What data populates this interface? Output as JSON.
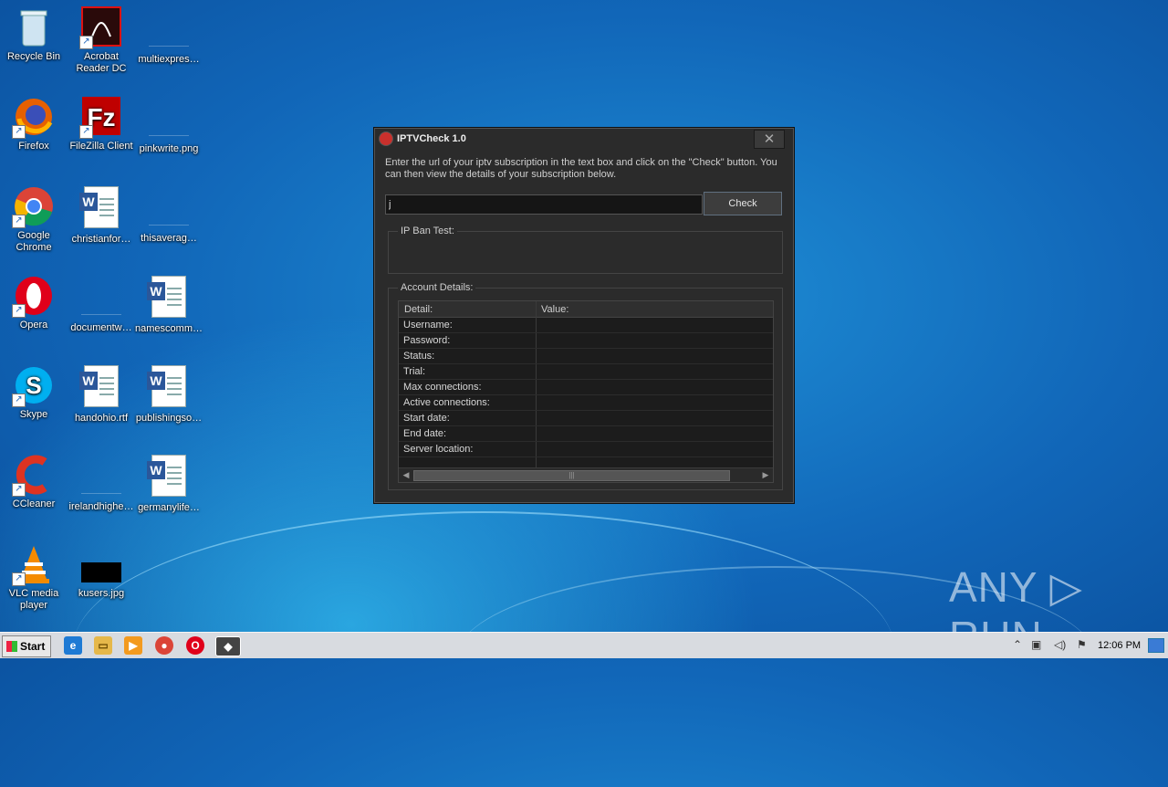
{
  "desktop": {
    "icons": [
      {
        "label": "Recycle Bin",
        "icon": "recycle-bin-icon"
      },
      {
        "label": "Acrobat Reader DC",
        "icon": "acrobat-icon"
      },
      {
        "label": "multiexpres…",
        "icon": "file-icon"
      },
      {
        "label": "Firefox",
        "icon": "firefox-icon"
      },
      {
        "label": "FileZilla Client",
        "icon": "filezilla-icon"
      },
      {
        "label": "pinkwrite.png",
        "icon": "file-icon"
      },
      {
        "label": "Google Chrome",
        "icon": "chrome-icon"
      },
      {
        "label": "christianfor…",
        "icon": "word-doc-icon"
      },
      {
        "label": "thisaverag…",
        "icon": "file-icon"
      },
      {
        "label": "Opera",
        "icon": "opera-icon"
      },
      {
        "label": "documentw…",
        "icon": "file-icon"
      },
      {
        "label": "namescomm…",
        "icon": "word-doc-icon"
      },
      {
        "label": "Skype",
        "icon": "skype-icon"
      },
      {
        "label": "handohio.rtf",
        "icon": "word-doc-icon"
      },
      {
        "label": "publishingso…",
        "icon": "word-doc-icon"
      },
      {
        "label": "CCleaner",
        "icon": "ccleaner-icon"
      },
      {
        "label": "irelandhighe…",
        "icon": "file-icon"
      },
      {
        "label": "germanylife…",
        "icon": "word-doc-icon"
      },
      {
        "label": "VLC media player",
        "icon": "vlc-icon"
      },
      {
        "label": "kusers.jpg",
        "icon": "image-icon"
      }
    ]
  },
  "window": {
    "title": "IPTVCheck 1.0",
    "close_glyph": "✕",
    "description": "Enter the url of your iptv subscription in the text box and click on the \"Check\" button. You can then view the details of your subscription below.",
    "url_value": "j",
    "check_label": "Check",
    "ipban_label": "IP Ban Test:",
    "account_label": "Account Details:",
    "columns": {
      "detail": "Detail:",
      "value": "Value:"
    },
    "rows": [
      "Username:",
      "Password:",
      "Status:",
      "Trial:",
      "Max connections:",
      "Active connections:",
      "Start date:",
      "End date:",
      "Server location:"
    ]
  },
  "taskbar": {
    "start_label": "Start",
    "clock": "12:06 PM"
  },
  "watermark": "ANY ▷ RUN",
  "colors": {
    "accent": "#1166b8",
    "window_bg": "#2b2b2b"
  }
}
